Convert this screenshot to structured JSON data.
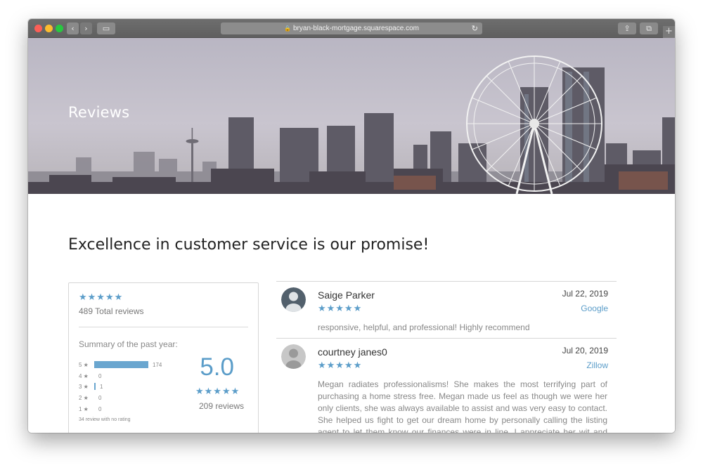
{
  "browser": {
    "url": "bryan-black-mortgage.squarespace.com",
    "back_glyph": "‹",
    "forward_glyph": "›",
    "sidebar_glyph": "▭",
    "share_glyph": "⇪",
    "tabs_glyph": "⧉",
    "lock_glyph": "🔒",
    "reload_glyph": "↻",
    "new_tab_glyph": "+"
  },
  "hero": {
    "title": "Reviews"
  },
  "main": {
    "headline": "Excellence in customer service is our promise!"
  },
  "summary": {
    "stars": "★★★★★",
    "total_reviews": "489 Total reviews",
    "past_year_label": "Summary of the past year:",
    "rating_rows": [
      {
        "label": "5 ★",
        "count": "174",
        "fraction": 1.0
      },
      {
        "label": "4 ★",
        "count": "0",
        "fraction": 0
      },
      {
        "label": "3 ★",
        "count": "1",
        "fraction": 0.006
      },
      {
        "label": "2 ★",
        "count": "0",
        "fraction": 0
      },
      {
        "label": "1 ★",
        "count": "0",
        "fraction": 0
      }
    ],
    "no_rating": "34 review with no rating",
    "score": "5.0",
    "score_stars": "★★★★★",
    "score_reviews": "209 reviews"
  },
  "reviews": [
    {
      "name": "Saige Parker",
      "date": "Jul 22, 2019",
      "source": "Google",
      "stars": "★★★★★",
      "text": "responsive, helpful, and professional! Highly recommend"
    },
    {
      "name": "courtney janes0",
      "date": "Jul 20, 2019",
      "source": "Zillow",
      "stars": "★★★★★",
      "text": "Megan radiates professionalisms! She makes the most terrifying part of purchasing a home stress free. Megan made us feel as though we were her only clients, she was always available to assist and was very easy to contact. She helped us fight to get our dream home by personally calling the listing agent to let them know our finances were in line. I appreciate her wit and humor"
    }
  ],
  "colors": {
    "accent": "#5b9dc9",
    "bar": "#6aa6cf"
  }
}
